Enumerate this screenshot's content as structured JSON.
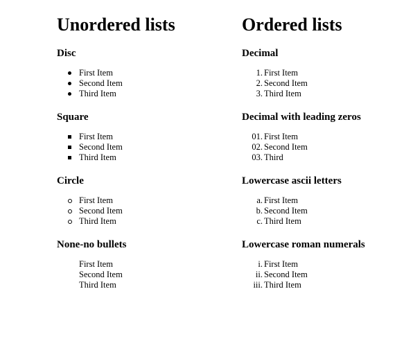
{
  "unordered": {
    "heading": "Unordered lists",
    "sections": [
      {
        "title": "Disc",
        "style": "disc",
        "items": [
          "First Item",
          "Second Item",
          "Third Item"
        ]
      },
      {
        "title": "Square",
        "style": "square",
        "items": [
          "First Item",
          "Second Item",
          "Third Item"
        ]
      },
      {
        "title": "Circle",
        "style": "circle",
        "items": [
          "First Item",
          "Second Item",
          "Third Item"
        ]
      },
      {
        "title": "None-no bullets",
        "style": "none",
        "items": [
          "First Item",
          "Second Item",
          "Third Item"
        ]
      }
    ]
  },
  "ordered": {
    "heading": "Ordered lists",
    "sections": [
      {
        "title": "Decimal",
        "markers": [
          "1.",
          "2.",
          "3."
        ],
        "items": [
          "First Item",
          "Second Item",
          "Third Item"
        ]
      },
      {
        "title": "Decimal with leading zeros",
        "markers": [
          "01.",
          "02.",
          "03."
        ],
        "items": [
          "First Item",
          "Second Item",
          "Third"
        ]
      },
      {
        "title": "Lowercase ascii letters",
        "markers": [
          "a.",
          "b.",
          "c."
        ],
        "items": [
          "First Item",
          "Second Item",
          "Third Item"
        ]
      },
      {
        "title": "Lowercase roman numerals",
        "markers": [
          "i.",
          "ii.",
          "iii."
        ],
        "items": [
          "First Item",
          "Second Item",
          "Third Item"
        ]
      }
    ]
  }
}
